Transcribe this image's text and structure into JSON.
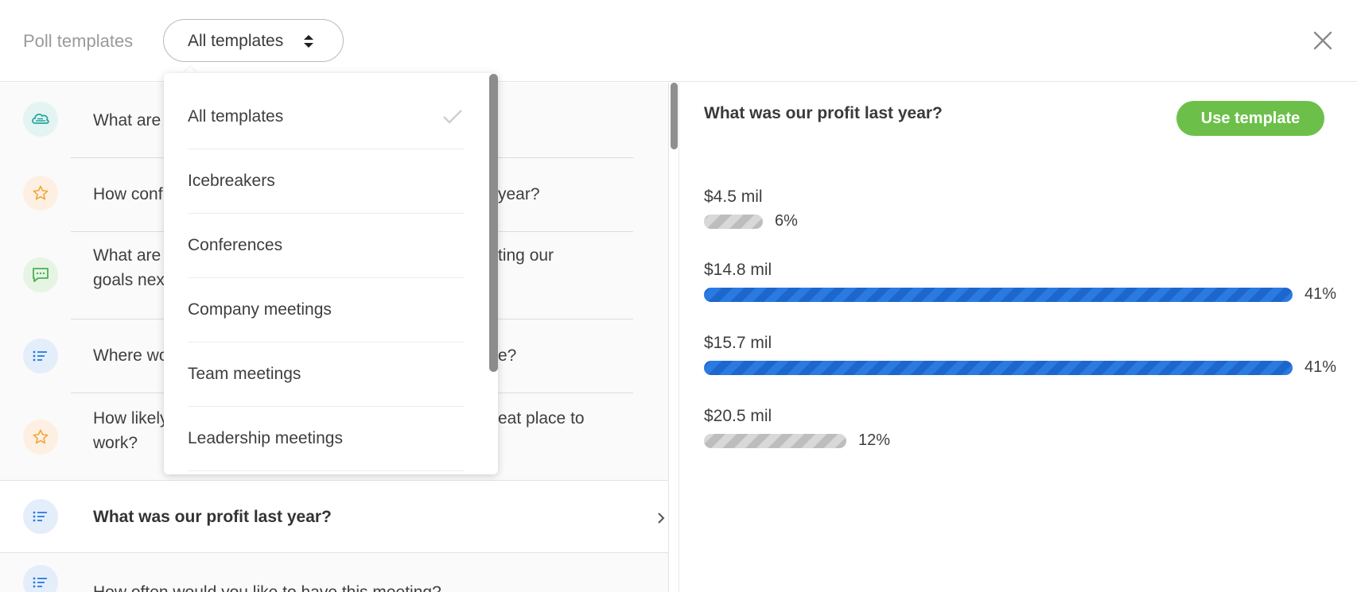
{
  "header": {
    "title": "Poll templates",
    "filter_label": "All templates"
  },
  "list": {
    "items": [
      {
        "icon": "cloud-icon",
        "text": "What are"
      },
      {
        "icon": "star-icon",
        "text_left": "How conf",
        "text_right": "year?"
      },
      {
        "icon": "chat-icon",
        "text_left": "What are",
        "text_right": "ting our",
        "text_line2": "goals nex"
      },
      {
        "icon": "list-icon",
        "text_left": "Where wo",
        "text_right": "e?"
      },
      {
        "icon": "star-icon",
        "text_left": "How likely",
        "text_right": "eat place to",
        "text_line2": "work?"
      },
      {
        "icon": "list-icon",
        "text": "What was our profit last year?",
        "selected": true
      },
      {
        "icon": "list-icon",
        "text": "How often would you like to have this meeting?"
      }
    ]
  },
  "dropdown": {
    "options": [
      {
        "label": "All templates",
        "checked": true
      },
      {
        "label": "Icebreakers"
      },
      {
        "label": "Conferences"
      },
      {
        "label": "Company meetings"
      },
      {
        "label": "Team meetings"
      },
      {
        "label": "Leadership meetings"
      }
    ]
  },
  "preview": {
    "question": "What was our profit last year?",
    "use_button": "Use template",
    "options": [
      {
        "label": "$4.5 mil",
        "percent_text": "6%",
        "percent": 6,
        "highlight": false
      },
      {
        "label": "$14.8 mil",
        "percent_text": "41%",
        "percent": 41,
        "highlight": true
      },
      {
        "label": "$15.7 mil",
        "percent_text": "41%",
        "percent": 41,
        "highlight": true
      },
      {
        "label": "$20.5 mil",
        "percent_text": "12%",
        "percent": 12,
        "highlight": false
      }
    ]
  },
  "colors": {
    "accent_green": "#6cc04a",
    "bar_blue": "#2a7ae2",
    "bar_grey": "#bdbdbd"
  }
}
